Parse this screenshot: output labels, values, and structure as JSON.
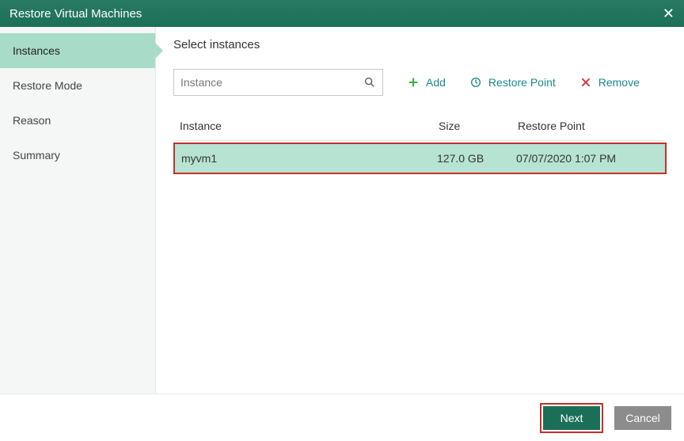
{
  "titlebar": {
    "title": "Restore Virtual Machines"
  },
  "sidebar": {
    "steps": [
      {
        "label": "Instances",
        "active": true
      },
      {
        "label": "Restore Mode",
        "active": false
      },
      {
        "label": "Reason",
        "active": false
      },
      {
        "label": "Summary",
        "active": false
      }
    ]
  },
  "main": {
    "subtitle": "Select instances",
    "search": {
      "placeholder": "Instance"
    },
    "actions": {
      "add": "Add",
      "restore_point": "Restore Point",
      "remove": "Remove"
    },
    "table": {
      "headers": {
        "instance": "Instance",
        "size": "Size",
        "restore_point": "Restore Point"
      },
      "rows": [
        {
          "instance": "myvm1",
          "size": "127.0 GB",
          "restore_point": "07/07/2020 1:07 PM",
          "selected": true
        }
      ]
    }
  },
  "footer": {
    "next": "Next",
    "cancel": "Cancel"
  }
}
